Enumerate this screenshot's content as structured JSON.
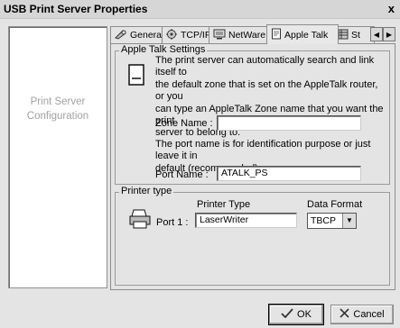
{
  "window": {
    "title": "USB Print Server Properties",
    "close_label": "x"
  },
  "sidebar": {
    "label_line1": "Print Server",
    "label_line2": "Configuration"
  },
  "tabs": [
    {
      "label": "General",
      "icon": "gear-icon"
    },
    {
      "label": "TCP/IP",
      "icon": "network-icon"
    },
    {
      "label": "NetWare",
      "icon": "netware-icon"
    },
    {
      "label": "Apple Talk",
      "icon": "document-icon"
    },
    {
      "label": "St",
      "icon": "status-icon"
    }
  ],
  "appletalk": {
    "group_title": "Apple Talk Settings",
    "description": [
      "The print server can automatically search and link itself to",
      "the default zone that is set on the AppleTalk router, or you",
      "can type an AppleTalk Zone name that you want the print",
      "server to belong to."
    ],
    "zone_label": "Zone Name :",
    "zone_value": "",
    "port_note": [
      "The port name is for identification purpose or just leave it in",
      "default (recommended)."
    ],
    "port_label": "Port Name :",
    "port_value": "ATALK_PS"
  },
  "printer": {
    "group_title": "Printer type",
    "type_header": "Printer Type",
    "format_header": "Data Format",
    "port_label": "Port 1 :",
    "type_value": "LaserWriter",
    "format_value": "TBCP"
  },
  "buttons": {
    "ok": "OK",
    "cancel": "Cancel"
  }
}
